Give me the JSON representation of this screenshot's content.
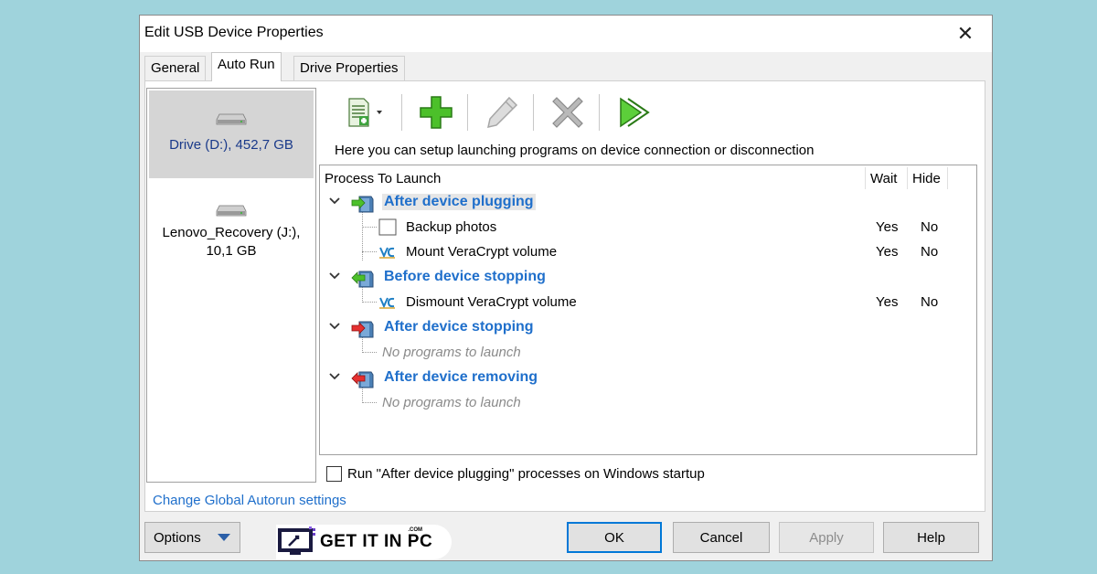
{
  "window": {
    "title": "Edit USB Device Properties",
    "close_glyph": "✕"
  },
  "tabs": [
    {
      "label": "General"
    },
    {
      "label": "Auto Run"
    },
    {
      "label": "Drive Properties"
    }
  ],
  "devices": [
    {
      "line1": "Drive (D:), 452,7 GB",
      "line2": ""
    },
    {
      "line1": "Lenovo_Recovery (J:),",
      "line2": "10,1 GB"
    }
  ],
  "toolbar": {
    "new_icon": "new-document-icon",
    "add_icon": "add-icon",
    "edit_icon": "pencil-icon",
    "delete_icon": "delete-icon",
    "run_icon": "run-icon"
  },
  "hint": "Here you can setup launching programs on device connection or disconnection",
  "tree": {
    "columns": {
      "process": "Process To Launch",
      "wait": "Wait",
      "hide": "Hide"
    },
    "groups": [
      {
        "title": "After device plugging",
        "items": [
          {
            "name": "Backup photos",
            "wait": "Yes",
            "hide": "No"
          },
          {
            "name": "Mount VeraCrypt volume",
            "wait": "Yes",
            "hide": "No"
          }
        ]
      },
      {
        "title": "Before device stopping",
        "items": [
          {
            "name": "Dismount VeraCrypt volume",
            "wait": "Yes",
            "hide": "No"
          }
        ]
      },
      {
        "title": "After device stopping",
        "empty": "No programs to launch"
      },
      {
        "title": "After device removing",
        "empty": "No programs to launch"
      }
    ]
  },
  "checkbox_label": "Run \"After device plugging\" processes on Windows startup",
  "link": "Change Global Autorun settings",
  "buttons": {
    "options": "Options",
    "ok": "OK",
    "cancel": "Cancel",
    "apply": "Apply",
    "help": "Help"
  },
  "watermark": {
    "text": "GET IT IN PC",
    "suffix": ".COM"
  },
  "colors": {
    "accent": "#1f6fcb",
    "background": "#9fd3dc",
    "selection": "#d5d5d5"
  }
}
